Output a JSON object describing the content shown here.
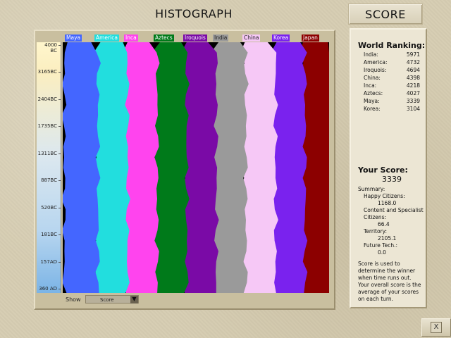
{
  "header": {
    "histograph_title": "HISTOGRAPH",
    "score_title": "SCORE"
  },
  "years": [
    "4000 BC",
    "3165BC",
    "2404BC",
    "1735BC",
    "1311BC",
    "887BC",
    "520BC",
    "181BC",
    "157AD",
    "360 AD"
  ],
  "civilizations": [
    {
      "name": "Maya",
      "color": "#4466ff"
    },
    {
      "name": "America",
      "color": "#22dede"
    },
    {
      "name": "Inca",
      "color": "#ff44ee"
    },
    {
      "name": "Aztecs",
      "color": "#007a1a"
    },
    {
      "name": "Iroquois",
      "color": "#7a0aa6"
    },
    {
      "name": "India",
      "color": "#9a9a9a"
    },
    {
      "name": "China",
      "color": "#f6c8f6"
    },
    {
      "name": "Korea",
      "color": "#7a22ee"
    },
    {
      "name": "Japan",
      "color": "#8c0000"
    }
  ],
  "chart_data": {
    "type": "area",
    "title": "HISTOGRAPH",
    "series": [
      {
        "name": "Maya"
      },
      {
        "name": "America"
      },
      {
        "name": "Inca"
      },
      {
        "name": "Aztecs"
      },
      {
        "name": "Iroquois"
      },
      {
        "name": "India"
      },
      {
        "name": "China"
      },
      {
        "name": "Korea"
      },
      {
        "name": "Japan"
      }
    ],
    "y_ticks": [
      "4000 BC",
      "3165BC",
      "2404BC",
      "1735BC",
      "1311BC",
      "887BC",
      "520BC",
      "181BC",
      "157AD",
      "360 AD"
    ]
  },
  "show_control": {
    "label": "Show",
    "selected": "Score"
  },
  "ranking": {
    "title": "World Ranking:",
    "rows": [
      {
        "name": "India:",
        "score": "5971"
      },
      {
        "name": "America:",
        "score": "4732"
      },
      {
        "name": "Iroquois:",
        "score": "4694"
      },
      {
        "name": "China:",
        "score": "4398"
      },
      {
        "name": "Inca:",
        "score": "4218"
      },
      {
        "name": "Aztecs:",
        "score": "4027"
      },
      {
        "name": "Maya:",
        "score": "3339"
      },
      {
        "name": "Korea:",
        "score": "3104"
      }
    ]
  },
  "your_score": {
    "label": "Your Score:",
    "value": "3339",
    "summary_label": "Summary:",
    "happy_label": "Happy Citizens:",
    "happy_value": "1168.0",
    "content_label": "Content and Specialist Citizens:",
    "content_value": "66.4",
    "territory_label": "Territory:",
    "territory_value": "2105.1",
    "future_label": "Future Tech.:",
    "future_value": "0.0",
    "note": "Score is used to determine the winner when time runs out. Your overall score is the average of your scores on each turn."
  },
  "close_button": {
    "label": "X"
  }
}
